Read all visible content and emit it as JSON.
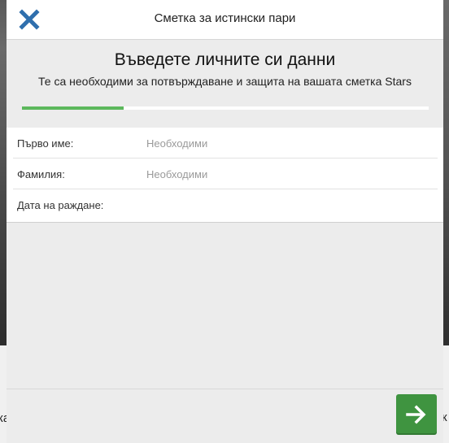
{
  "backdrop": {
    "left_glyph": "ка",
    "right_glyph": "к"
  },
  "header": {
    "title": "Сметка за истински пари",
    "close_icon": "close-x-icon"
  },
  "main": {
    "heading": "Въведете личните си данни",
    "subheading": "Те са необходими за потвърждаване и защита на вашата сметка Stars",
    "progress": {
      "fraction": 0.25
    }
  },
  "form": {
    "fields": [
      {
        "label": "Първо име:",
        "placeholder": "Необходими",
        "value": ""
      },
      {
        "label": "Фамилия:",
        "placeholder": "Необходими",
        "value": ""
      },
      {
        "label": "Дата на раждане:",
        "placeholder": "",
        "value": ""
      }
    ]
  },
  "footer": {
    "next_icon": "arrow-right-icon"
  },
  "colors": {
    "accent_blue": "#2f6fad",
    "progress_green": "#5cb85c",
    "button_green": "#3f9440"
  }
}
